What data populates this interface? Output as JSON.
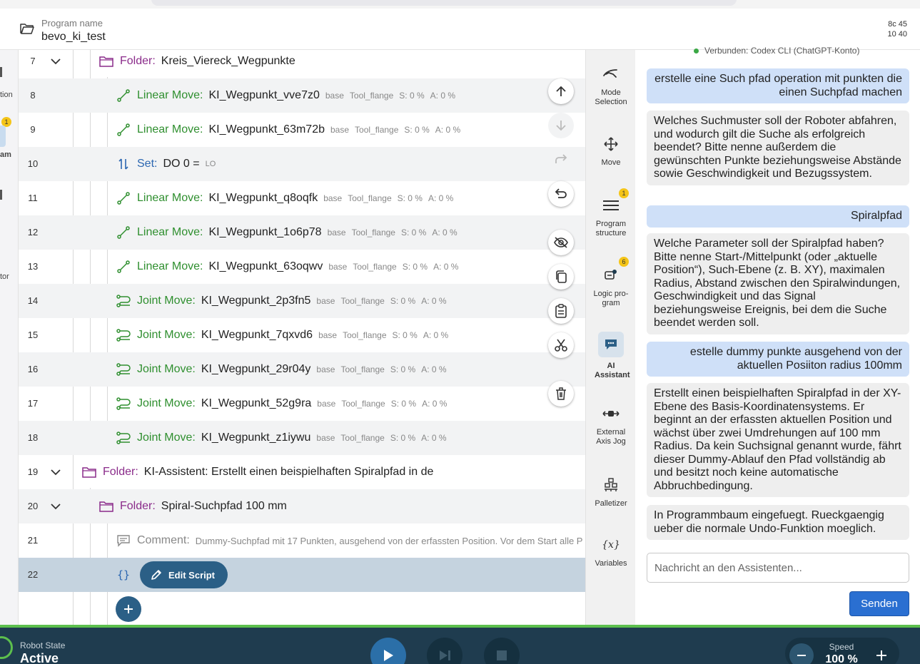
{
  "header": {
    "program_label": "Program name",
    "program_name": "bevo_ki_test",
    "corner_line1": "8c 45",
    "corner_line2": "10 40"
  },
  "left_rail": {
    "frag_top": "tion",
    "badge": "1",
    "frag_mid": "am",
    "frag_bottom": "tor"
  },
  "tree": {
    "rows": [
      {
        "num": "7",
        "keyword": "Folder:",
        "name": "Kreis_Viereck_Wegpunkte"
      },
      {
        "num": "8",
        "keyword": "Linear Move:",
        "name": "KI_Wegpunkt_vve7z0",
        "base": "base",
        "tool": "Tool_flange",
        "speed": "S: 0 %",
        "accel": "A: 0 %"
      },
      {
        "num": "9",
        "keyword": "Linear Move:",
        "name": "KI_Wegpunkt_63m72b",
        "base": "base",
        "tool": "Tool_flange",
        "speed": "S: 0 %",
        "accel": "A: 0 %"
      },
      {
        "num": "10",
        "keyword": "Set:",
        "name": "DO 0 =",
        "value": "LO"
      },
      {
        "num": "11",
        "keyword": "Linear Move:",
        "name": "KI_Wegpunkt_q8oqfk",
        "base": "base",
        "tool": "Tool_flange",
        "speed": "S: 0 %",
        "accel": "A: 0 %"
      },
      {
        "num": "12",
        "keyword": "Linear Move:",
        "name": "KI_Wegpunkt_1o6p78",
        "base": "base",
        "tool": "Tool_flange",
        "speed": "S: 0 %",
        "accel": "A: 0 %"
      },
      {
        "num": "13",
        "keyword": "Linear Move:",
        "name": "KI_Wegpunkt_63oqwv",
        "base": "base",
        "tool": "Tool_flange",
        "speed": "S: 0 %",
        "accel": "A: 0 %"
      },
      {
        "num": "14",
        "keyword": "Joint Move:",
        "name": "KI_Wegpunkt_2p3fn5",
        "base": "base",
        "tool": "Tool_flange",
        "speed": "S: 0 %",
        "accel": "A: 0 %"
      },
      {
        "num": "15",
        "keyword": "Joint Move:",
        "name": "KI_Wegpunkt_7qxvd6",
        "base": "base",
        "tool": "Tool_flange",
        "speed": "S: 0 %",
        "accel": "A: 0 %"
      },
      {
        "num": "16",
        "keyword": "Joint Move:",
        "name": "KI_Wegpunkt_29r04y",
        "base": "base",
        "tool": "Tool_flange",
        "speed": "S: 0 %",
        "accel": "A: 0 %"
      },
      {
        "num": "17",
        "keyword": "Joint Move:",
        "name": "KI_Wegpunkt_52g9ra",
        "base": "base",
        "tool": "Tool_flange",
        "speed": "S: 0 %",
        "accel": "A: 0 %"
      },
      {
        "num": "18",
        "keyword": "Joint Move:",
        "name": "KI_Wegpunkt_z1iywu",
        "base": "base",
        "tool": "Tool_flange",
        "speed": "S: 0 %",
        "accel": "A: 0 %"
      },
      {
        "num": "19",
        "keyword": "Folder:",
        "name": "KI-Assistent: Erstellt einen beispielhaften Spiralpfad in de"
      },
      {
        "num": "20",
        "keyword": "Folder:",
        "name": "Spiral-Suchpfad 100 mm"
      },
      {
        "num": "21",
        "keyword": "Comment:",
        "text": "Dummy-Suchpfad mit 17 Punkten, ausgehend von der erfassten Position. Vor dem Start alle P"
      },
      {
        "num": "22",
        "button": "Edit Script"
      }
    ]
  },
  "side_panel": {
    "mode_selection": "Mode Selection",
    "move": "Move",
    "program_structure": "Program structure",
    "program_structure_badge": "1",
    "logic_program": "Logic pro-gram",
    "logic_program_badge": "6",
    "ai_assistant": "AI Assistant",
    "external_axis_jog": "External Axis Jog",
    "palletizer": "Palletizer",
    "variables": "Variables",
    "variables_icon_text": "{x}"
  },
  "chat": {
    "status": "Verbunden: Codex CLI (ChatGPT-Konto)",
    "messages": [
      {
        "role": "user",
        "text": "erstelle eine Such pfad operation mit punkten die einen Suchpfad machen"
      },
      {
        "role": "assistant",
        "text": "Welches Suchmuster soll der Roboter abfahren, und wodurch gilt die Suche als erfolgreich beendet? Bitte nenne außerdem die gewünschten Punkte beziehungsweise Abstände sowie Geschwindigkeit und Bezugssystem."
      },
      {
        "role": "user",
        "text": "Spiralpfad"
      },
      {
        "role": "assistant",
        "text": "Welche Parameter soll der Spiralpfad haben? Bitte nenne Start-/Mittelpunkt (oder „aktuelle Position“), Such-Ebene (z. B. XY), maximalen Radius, Abstand zwischen den Spiralwindungen, Geschwindigkeit und das Signal beziehungsweise Ereignis, bei dem die Suche beendet werden soll."
      },
      {
        "role": "user",
        "text": "estelle dummy punkte ausgehend von der aktuellen Posiiton radius 100mm"
      },
      {
        "role": "assistant",
        "text": "Erstellt einen beispielhaften Spiralpfad in der XY-Ebene des Basis-Koordinatensystems. Er beginnt an der erfassten aktuellen Position und wächst über zwei Umdrehungen auf 100 mm Radius. Da kein Suchsignal genannt wurde, fährt dieser Dummy-Ablauf den Pfad vollständig ab und besitzt noch keine automatische Abbruchbedingung."
      },
      {
        "role": "assistant",
        "text": "In Programmbaum eingefuegt. Rueckgaengig ueber die normale Undo-Funktion moeglich."
      }
    ],
    "input_placeholder": "Nachricht an den Assistenten...",
    "send_label": "Senden"
  },
  "bottom_bar": {
    "robot_state_label": "Robot State",
    "robot_state_value": "Active",
    "speed_label": "Speed",
    "speed_value": "100 %"
  },
  "colors": {
    "linear_move": "#2f8f2f",
    "folder": "#8a2b8a",
    "set": "#2c67b1",
    "accent": "#2b5f86",
    "status_green": "#5cbf4d",
    "bottom_bar": "#1f3c4f"
  }
}
